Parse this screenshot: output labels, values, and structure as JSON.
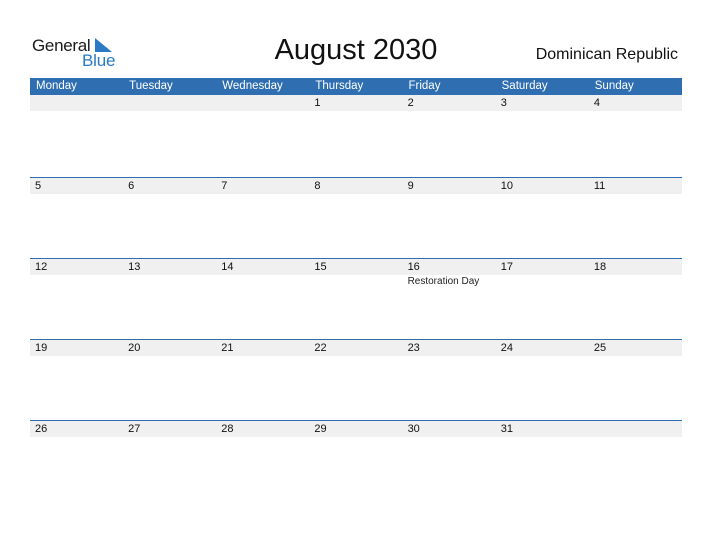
{
  "logo": {
    "line1": "General",
    "line2": "Blue"
  },
  "title": "August 2030",
  "country": "Dominican Republic",
  "colors": {
    "accent": "#2f6eb0",
    "band": "#f0f0f0",
    "logo_blue": "#2a7bc4"
  },
  "weekdays": [
    "Monday",
    "Tuesday",
    "Wednesday",
    "Thursday",
    "Friday",
    "Saturday",
    "Sunday"
  ],
  "weeks": [
    {
      "days": [
        {
          "num": ""
        },
        {
          "num": ""
        },
        {
          "num": ""
        },
        {
          "num": "1"
        },
        {
          "num": "2"
        },
        {
          "num": "3"
        },
        {
          "num": "4"
        }
      ]
    },
    {
      "days": [
        {
          "num": "5"
        },
        {
          "num": "6"
        },
        {
          "num": "7"
        },
        {
          "num": "8"
        },
        {
          "num": "9"
        },
        {
          "num": "10"
        },
        {
          "num": "11"
        }
      ]
    },
    {
      "days": [
        {
          "num": "12"
        },
        {
          "num": "13"
        },
        {
          "num": "14"
        },
        {
          "num": "15"
        },
        {
          "num": "16",
          "event": "Restoration Day"
        },
        {
          "num": "17"
        },
        {
          "num": "18"
        }
      ]
    },
    {
      "days": [
        {
          "num": "19"
        },
        {
          "num": "20"
        },
        {
          "num": "21"
        },
        {
          "num": "22"
        },
        {
          "num": "23"
        },
        {
          "num": "24"
        },
        {
          "num": "25"
        }
      ]
    },
    {
      "days": [
        {
          "num": "26"
        },
        {
          "num": "27"
        },
        {
          "num": "28"
        },
        {
          "num": "29"
        },
        {
          "num": "30"
        },
        {
          "num": "31"
        },
        {
          "num": ""
        }
      ]
    }
  ]
}
